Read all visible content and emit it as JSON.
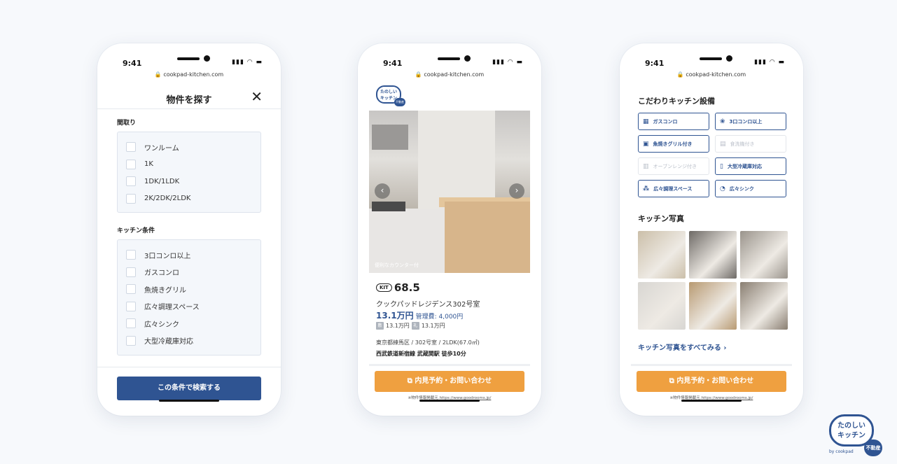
{
  "status": {
    "time": "9:41",
    "url": "cookpad-kitchen.com",
    "icons": "▮▮▮ ◠ ▬"
  },
  "screen1": {
    "title": "物件を探す",
    "close": "✕",
    "layout_label": "間取り",
    "layout_options": [
      "ワンルーム",
      "1K",
      "1DK/1LDK",
      "2K/2DK/2LDK"
    ],
    "kitchen_label": "キッチン条件",
    "kitchen_options": [
      "3口コンロ以上",
      "ガスコンロ",
      "魚焼きグリル",
      "広々調理スペース",
      "広々シンク",
      "大型冷蔵庫対応"
    ],
    "search_button": "この条件で検索する"
  },
  "screen2": {
    "logo_text": "たのしい\nキッチン",
    "logo_tag": "不動産",
    "photo_caption": "便利なカウンター付",
    "prev": "‹",
    "next": "›",
    "kit_icon": "KIT",
    "kit_score": "68.5",
    "name": "クックパッドレジデンス302号室",
    "price": "13.1万円",
    "management_fee": "管理費: 4,000円",
    "deposit_tag": "敷",
    "deposit": "13.1万円",
    "key_money_tag": "礼",
    "key_money": "13.1万円",
    "address": "東京都練馬区 / 302号室 / 2LDK(67.0㎡)",
    "station": "西武鉄道新宿線 武蔵関駅 徒歩10分",
    "cta": "内見予約・お問い合わせ",
    "source_label": "※物件情報掲載元",
    "source_url": "https://www.goodrooms.jp/"
  },
  "screen3": {
    "features_title": "こだわりキッチン設備",
    "features": [
      {
        "label": "ガスコンロ",
        "icon": "stove-icon",
        "glyph": "▦",
        "active": true
      },
      {
        "label": "3口コンロ以上",
        "icon": "three-burner-icon",
        "glyph": "❀",
        "active": true
      },
      {
        "label": "魚焼きグリル付き",
        "icon": "grill-icon",
        "glyph": "▣",
        "active": true
      },
      {
        "label": "食洗機付き",
        "icon": "dishwasher-icon",
        "glyph": "▤",
        "active": false
      },
      {
        "label": "オーブンレンジ付き",
        "icon": "oven-icon",
        "glyph": "▥",
        "active": false
      },
      {
        "label": "大型冷蔵庫対応",
        "icon": "fridge-icon",
        "glyph": "▯",
        "active": true
      },
      {
        "label": "広々調理スペース",
        "icon": "workspace-icon",
        "glyph": "⁂",
        "active": true
      },
      {
        "label": "広々シンク",
        "icon": "sink-icon",
        "glyph": "◔",
        "active": true
      }
    ],
    "photos_title": "キッチン写真",
    "photo_colors": [
      "#cbbfa9",
      "#6e6a66",
      "#9a948c",
      "#d8d6d2",
      "#b89a72",
      "#8a7f72"
    ],
    "see_all": "キッチン写真をすべてみる ›",
    "cta": "内見予約・お問い合わせ",
    "source_label": "※物件情報掲載元",
    "source_url": "https://www.goodrooms.jp/"
  },
  "brand": {
    "name": "たのしい\nキッチン",
    "tag": "不動産",
    "by": "by cookpad"
  }
}
